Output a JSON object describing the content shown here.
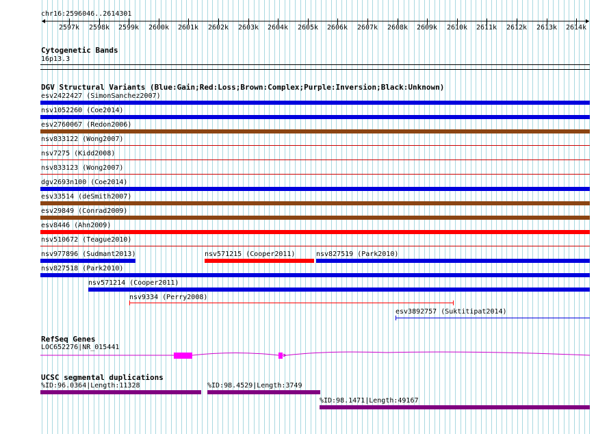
{
  "ruler": {
    "location": "chr16:2596046..2614301",
    "ticks": [
      "2597k",
      "2598k",
      "2599k",
      "2600k",
      "2601k",
      "2602k",
      "2603k",
      "2604k",
      "2605k",
      "2606k",
      "2607k",
      "2608k",
      "2609k",
      "2610k",
      "2611k",
      "2612k",
      "2613k",
      "2614k"
    ]
  },
  "cytobands": {
    "title": "Cytogenetic Bands",
    "band": "16p13.3"
  },
  "dgv": {
    "title": "DGV Structural Variants (Blue:Gain;Red:Loss;Brown:Complex;Purple:Inversion;Black:Unknown)",
    "colors": {
      "gain": "#0000dd",
      "loss": "#ff0000",
      "complex": "#8b4513",
      "thin_loss": "#cc0000"
    },
    "variants": [
      {
        "label": "esv2422427 (SimonSanchez2007)",
        "type": "gain",
        "style": "thick"
      },
      {
        "label": "nsv1052260 (Coe2014)",
        "type": "gain",
        "style": "thick"
      },
      {
        "label": "esv2760067 (Redon2006)",
        "type": "complex",
        "style": "thick"
      },
      {
        "label": "nsv833122 (Wong2007)",
        "type": "loss",
        "style": "thin"
      },
      {
        "label": "nsv7275 (Kidd2008)",
        "type": "loss",
        "style": "thin"
      },
      {
        "label": "nsv833123 (Wong2007)",
        "type": "loss",
        "style": "thin"
      },
      {
        "label": "dgv2693n100 (Coe2014)",
        "type": "gain",
        "style": "thick"
      },
      {
        "label": "esv33514 (deSmith2007)",
        "type": "complex",
        "style": "thick"
      },
      {
        "label": "esv29849 (Conrad2009)",
        "type": "complex",
        "style": "thick"
      },
      {
        "label": "esv8446 (Ahn2009)",
        "type": "loss",
        "style": "thick"
      },
      {
        "label": "nsv510672 (Teague2010)",
        "type": "loss",
        "style": "thin"
      },
      {
        "label": "nsv977896 (Sudmant2013)",
        "type": "gain",
        "style": "thick"
      },
      {
        "label": "nsv571215 (Cooper2011)",
        "type": "loss",
        "style": "thick"
      },
      {
        "label": "nsv827519 (Park2010)",
        "type": "gain",
        "style": "thick"
      },
      {
        "label": "nsv827518 (Park2010)",
        "type": "gain",
        "style": "thick"
      },
      {
        "label": "nsv571214 (Cooper2011)",
        "type": "gain",
        "style": "thick"
      },
      {
        "label": "nsv9334 (Perry2008)",
        "type": "loss",
        "style": "span"
      },
      {
        "label": "esv3892757 (Suktitipat2014)",
        "type": "gain",
        "style": "span"
      }
    ]
  },
  "refseq": {
    "title": "RefSeq Genes",
    "gene": "LOC652276|NR_015441",
    "color": "#cc00cc"
  },
  "segdup": {
    "title": "UCSC segmental duplications",
    "color": "#800080",
    "items": [
      {
        "label": "%ID:96.0364|Length:11328"
      },
      {
        "label": "%ID:98.4529|Length:3749"
      },
      {
        "label": "%ID:98.1471|Length:49167"
      }
    ]
  }
}
